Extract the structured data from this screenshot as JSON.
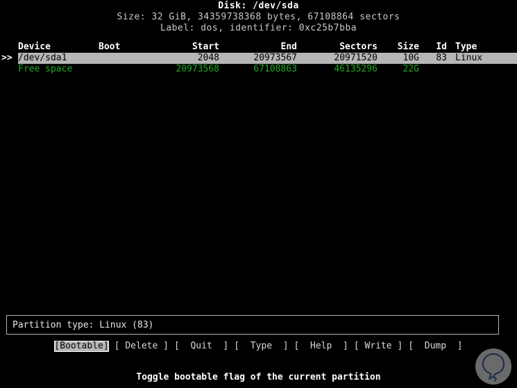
{
  "header": {
    "disk_line": "Disk: /dev/sda",
    "size_line": "Size: 32 GiB, 34359738368 bytes, 67108864 sectors",
    "label_line": "Label: dos, identifier: 0xc25b7bba"
  },
  "table": {
    "columns": [
      "Device",
      "Boot",
      "Start",
      "End",
      "Sectors",
      "Size",
      "Id",
      "Type"
    ],
    "rows": [
      {
        "marker": ">>",
        "device": "/dev/sda1",
        "boot": "",
        "start": "2048",
        "end": "20973567",
        "sectors": "20971520",
        "size": "10G",
        "id": "83",
        "type": "Linux",
        "state": "selected"
      },
      {
        "marker": "",
        "device": "Free space",
        "boot": "",
        "start": "20973568",
        "end": "67108863",
        "sectors": "46135296",
        "size": "22G",
        "id": "",
        "type": "",
        "state": "freespace"
      }
    ]
  },
  "type_box": {
    "text": "Partition type: Linux (83)"
  },
  "menu": {
    "items": [
      {
        "label": "[Bootable]",
        "active": true
      },
      {
        "label": "[ Delete ]",
        "active": false
      },
      {
        "label": "[  Quit  ]",
        "active": false
      },
      {
        "label": "[  Type  ]",
        "active": false
      },
      {
        "label": "[  Help  ]",
        "active": false
      },
      {
        "label": "[ Write ]",
        "active": false
      },
      {
        "label": "[  Dump  ]",
        "active": false
      }
    ]
  },
  "status": {
    "text": "Toggle bootable flag of the current partition"
  },
  "watermark": {
    "name": "balloon-logo-watermark",
    "circle_color": "#8e8e8e",
    "glyph_color": "#2b3f6b"
  },
  "colors": {
    "background": "#000000",
    "foreground": "#d8d8d8",
    "highlight_bg": "#b6b6b6",
    "highlight_fg": "#000000",
    "free_space": "#22aa22",
    "bright_white": "#ffffff"
  }
}
